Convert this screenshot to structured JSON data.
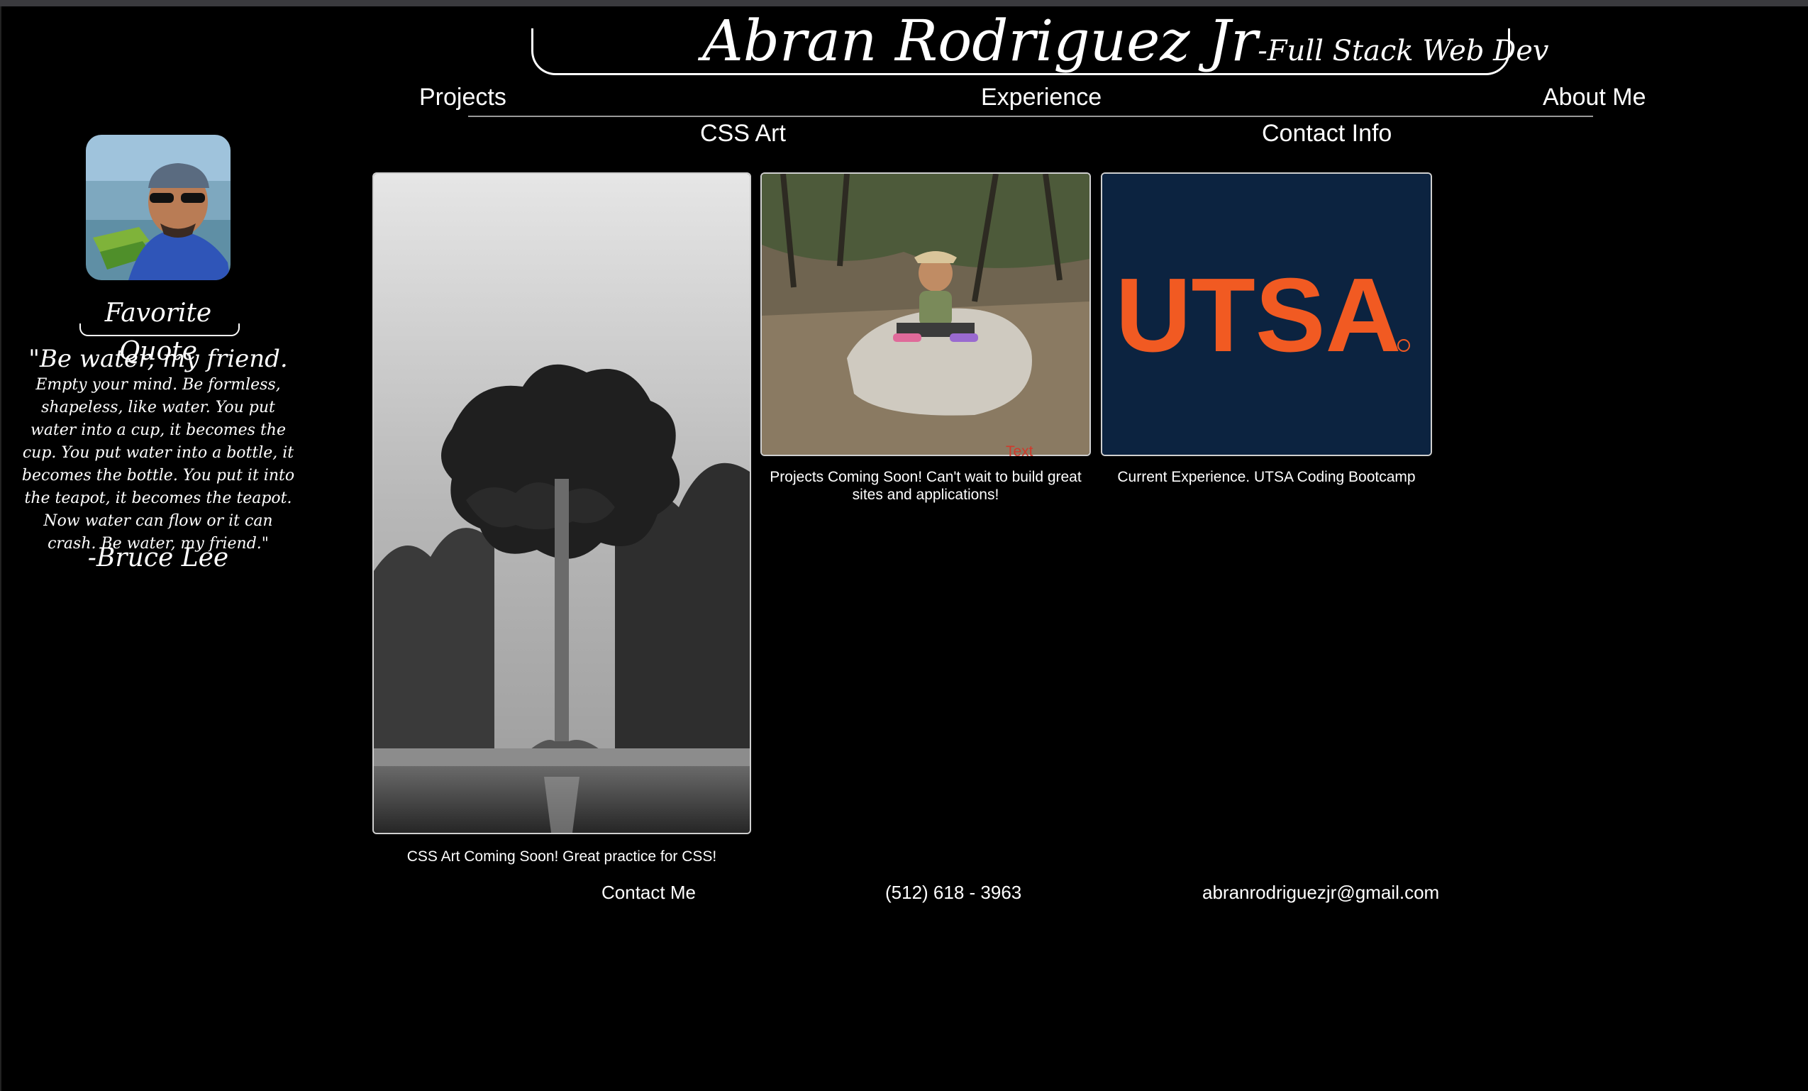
{
  "header": {
    "name": "Abran Rodriguez Jr",
    "role": "-Full Stack Web Dev"
  },
  "nav": {
    "projects": "Projects",
    "experience": "Experience",
    "about_me": "About Me",
    "css_art": "CSS Art",
    "contact_info": "Contact Info"
  },
  "sidebar": {
    "quote_heading": "Favorite Quote",
    "quote_lead": "\"Be water, my friend.",
    "quote_rest": "Empty your mind. Be formless, shapeless, like water. You put water into a cup, it becomes the cup. You put water into a bottle, it becomes the bottle. You put it into the teapot, it becomes the teapot. Now water can flow or it can crash. Be water, my friend.\"",
    "quote_author": "-Bruce Lee"
  },
  "cards": {
    "css_art_caption": "CSS Art Coming Soon! Great practice for CSS!",
    "projects_caption": "Projects Coming Soon! Can't wait to build great sites and applications!",
    "experience_caption": "Current Experience. UTSA Coding Bootcamp",
    "utsa_logo_text": "UTSA",
    "stray_label": "Text"
  },
  "footer": {
    "contact_me": "Contact Me",
    "phone": "(512) 618 - 3963",
    "email": "abranrodriguezjr@gmail.com"
  },
  "colors": {
    "background": "#000000",
    "utsa_navy": "#0c2340",
    "utsa_orange": "#f15a22",
    "stray_text": "#d03a2c"
  }
}
